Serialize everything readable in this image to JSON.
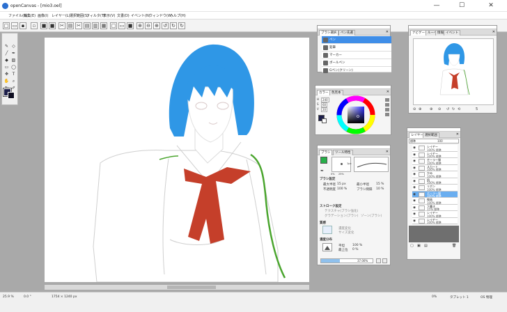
{
  "window": {
    "title": "openCanvas - [mio3.oel]",
    "minimize": "—",
    "maximize": "☐",
    "close": "✕"
  },
  "menu": [
    "ファイル(F)",
    "編集(E)",
    "画像(I)",
    "レイヤー(L)",
    "選択範囲(S)",
    "フィルタ(T)",
    "表示(V)",
    "文書(D)",
    "イベント(N)",
    "ウィンドウ(W)",
    "ヘルプ(H)"
  ],
  "brush_panel": {
    "tabs": [
      "ブラシ選択",
      "ペン先選"
    ],
    "items": [
      "ペン",
      "鉛筆",
      "マーカー",
      "ボールペン",
      "Gペン(クリーン)"
    ]
  },
  "color_panel": {
    "tabs": [
      "カラー",
      "色見本"
    ],
    "values": [
      "240",
      "60",
      "20"
    ]
  },
  "brush_settings": {
    "tabs": [
      "ブラシ",
      "ツール特性"
    ],
    "preview_labels": [
      "0%",
      "25%",
      "1px"
    ],
    "section_brush": "ブラシ設定",
    "max_diameter_label": "最大半径",
    "max_diameter_value": "15 px",
    "min_diameter_label": "最小半径",
    "min_diameter_value": "15 %",
    "density_label": "不透明度",
    "density_value": "100 %",
    "interval_label": "ブラシ間隔",
    "interval_value": "10 %",
    "section_stroke": "ストローク設定",
    "stroke_opt1": "テクスチャ(ブラシ強化)",
    "stroke_opt2": "グラデーション(ブラシ)",
    "stroke_opt3": "ゾーン(ブラシ)",
    "section_texture": "質感",
    "texture_opt1": "濃度変化",
    "texture_opt2": "サイズ変化",
    "section_density": "濃度分布",
    "density_val1_label": "平坦",
    "density_val1": "100 %",
    "density_val2_label": "最上位",
    "density_val2": "0 %",
    "progress": "37.00%",
    "progress_value": 37
  },
  "navigator": {
    "tabs": [
      "ナビゲータ",
      "ルーペ",
      "情報",
      "イベント"
    ],
    "zoom_value": "5"
  },
  "layers": {
    "tabs": [
      "レイヤー",
      "選択範囲"
    ],
    "blend_mode": "標準",
    "opacity": "100",
    "rows": [
      {
        "name": "レイヤー",
        "mode": "100% 標準"
      },
      {
        "name": "レイヤー",
        "mode": "100% 標準"
      },
      {
        "name": "セーラー服",
        "mode": "100% 標準"
      },
      {
        "name": "スカート",
        "mode": "100% 標準"
      },
      {
        "name": "かみ",
        "mode": "100% 標準"
      },
      {
        "name": "肌",
        "mode": "100% 標準"
      },
      {
        "name": "リボン",
        "mode": "100% 標準"
      },
      {
        "name": "セーラー服",
        "mode": "100% 標準"
      },
      {
        "name": "線画",
        "mode": "100% 標準"
      },
      {
        "name": "下書き",
        "mode": "15% 標準"
      },
      {
        "name": "レイヤー",
        "mode": "100% 標準"
      },
      {
        "name": "レイヤー",
        "mode": "100% 標準"
      }
    ]
  },
  "status": {
    "zoom": "25.9 %",
    "angle": "0.0 °",
    "size": "1754 × 1240 px",
    "mode": "0%",
    "tablet": "タブレット 1",
    "memory": "OS 物理"
  },
  "colors": {
    "hair": "#2f97e6",
    "ribbon": "#c53f2a",
    "collar_stripe": "#4aa52e",
    "accent": "#3f8ee8"
  }
}
